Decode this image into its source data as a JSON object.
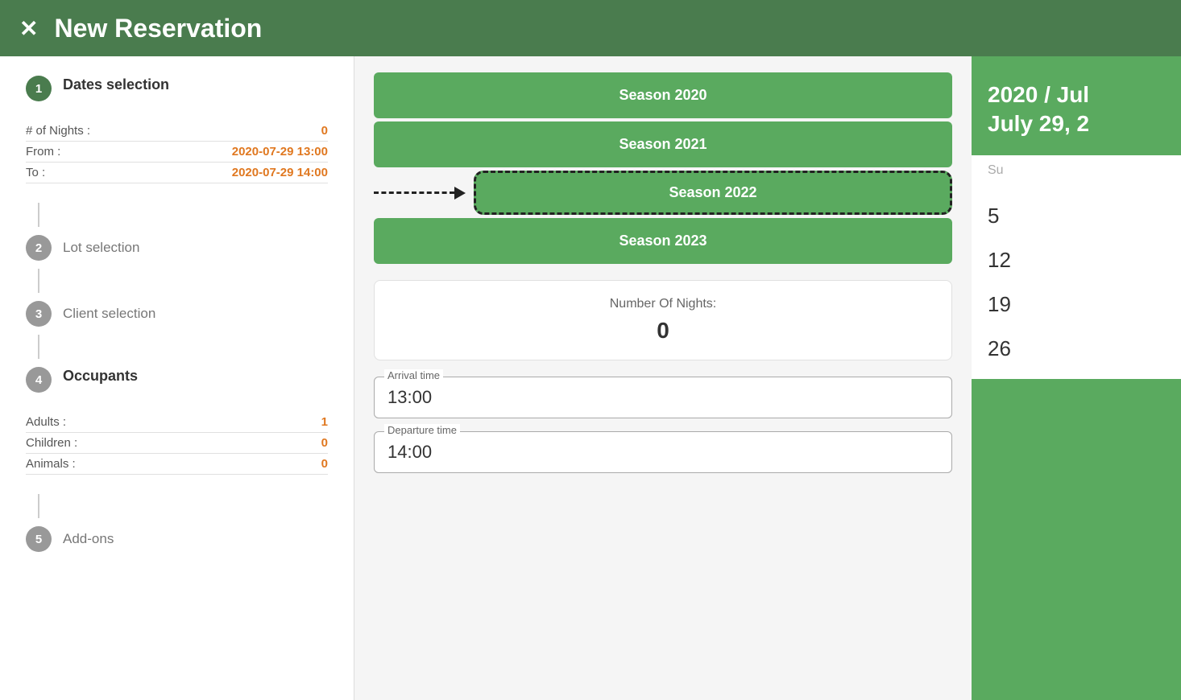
{
  "header": {
    "close_label": "✕",
    "title": "New Reservation"
  },
  "sidebar": {
    "steps": [
      {
        "id": 1,
        "label_section": "Dates selection",
        "active": true,
        "fields": [
          {
            "label": "# of Nights :",
            "value": "0"
          },
          {
            "label": "From :",
            "value": "2020-07-29 13:00"
          },
          {
            "label": "To :",
            "value": "2020-07-29 14:00"
          }
        ]
      },
      {
        "id": 2,
        "label": "Lot selection",
        "active": false
      },
      {
        "id": 3,
        "label": "Client selection",
        "active": false
      },
      {
        "id": 4,
        "label_section": "Occupants",
        "active": false,
        "fields": [
          {
            "label": "Adults :",
            "value": "1"
          },
          {
            "label": "Children :",
            "value": "0"
          },
          {
            "label": "Animals :",
            "value": "0"
          }
        ]
      },
      {
        "id": 5,
        "label": "Add-ons",
        "active": false
      }
    ]
  },
  "seasons": [
    {
      "id": "season-2020",
      "label": "Season 2020",
      "dashed": false
    },
    {
      "id": "season-2021",
      "label": "Season 2021",
      "dashed": false
    },
    {
      "id": "season-2022",
      "label": "Season 2022",
      "dashed": true
    },
    {
      "id": "season-2023",
      "label": "Season 2023",
      "dashed": false
    }
  ],
  "nights_box": {
    "label": "Number Of Nights:",
    "value": "0"
  },
  "arrival_time": {
    "label": "Arrival time",
    "value": "13:00"
  },
  "departure_time": {
    "label": "Departure time",
    "value": "14:00"
  },
  "calendar": {
    "year_month_line1": "2020 / Jul",
    "date_line": "July 29, 2",
    "day_header": "Su",
    "numbers": [
      "5",
      "12",
      "19",
      "26"
    ]
  }
}
